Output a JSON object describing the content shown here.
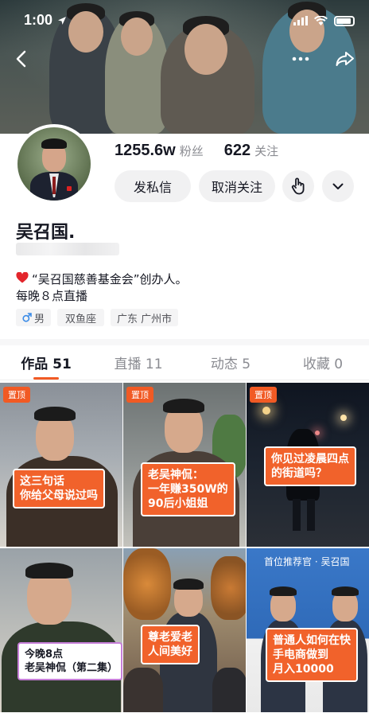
{
  "status_bar": {
    "time": "1:00"
  },
  "profile": {
    "followers_count": "1255.6w",
    "followers_label": "粉丝",
    "following_count": "622",
    "following_label": "关注",
    "message_button": "发私信",
    "unfollow_button": "取消关注",
    "name": "吴召国.",
    "bio_line1": "“吴召国慈善基金会”创办人。",
    "bio_line2": "每晚８点直播",
    "tags": {
      "gender": "男",
      "zodiac": "双鱼座",
      "location": "广东 广州市"
    }
  },
  "tabs": [
    {
      "label": "作品 51",
      "active": true
    },
    {
      "label": "直播 11",
      "active": false
    },
    {
      "label": "动态 5",
      "active": false
    },
    {
      "label": "收藏 0",
      "active": false
    }
  ],
  "videos": [
    {
      "pinned": "置顶",
      "caption_l1": "这三句话",
      "caption_l2": "你给父母说过吗"
    },
    {
      "pinned": "置顶",
      "caption_l1": "老吴神侃：",
      "caption_l2": "一年赚350W的",
      "caption_l3": "90后小姐姐"
    },
    {
      "pinned": "置顶",
      "caption_l1": "你见过凌晨四点",
      "caption_l2": "的街道吗？"
    },
    {
      "caption_l1": "今晚8点",
      "caption_l2": "老吴神侃（第二集）"
    },
    {
      "caption_l1": "尊老爱老",
      "caption_l2": "人间美好"
    },
    {
      "header": "首位推荐官 · 吴召国",
      "caption_l1": "普通人如何在快",
      "caption_l2": "手电商做到",
      "caption_l3": "月入10000"
    }
  ],
  "colors": {
    "accent": "#f15a24",
    "button_bg": "#f1f1f2",
    "muted_text": "#8a8b91"
  }
}
